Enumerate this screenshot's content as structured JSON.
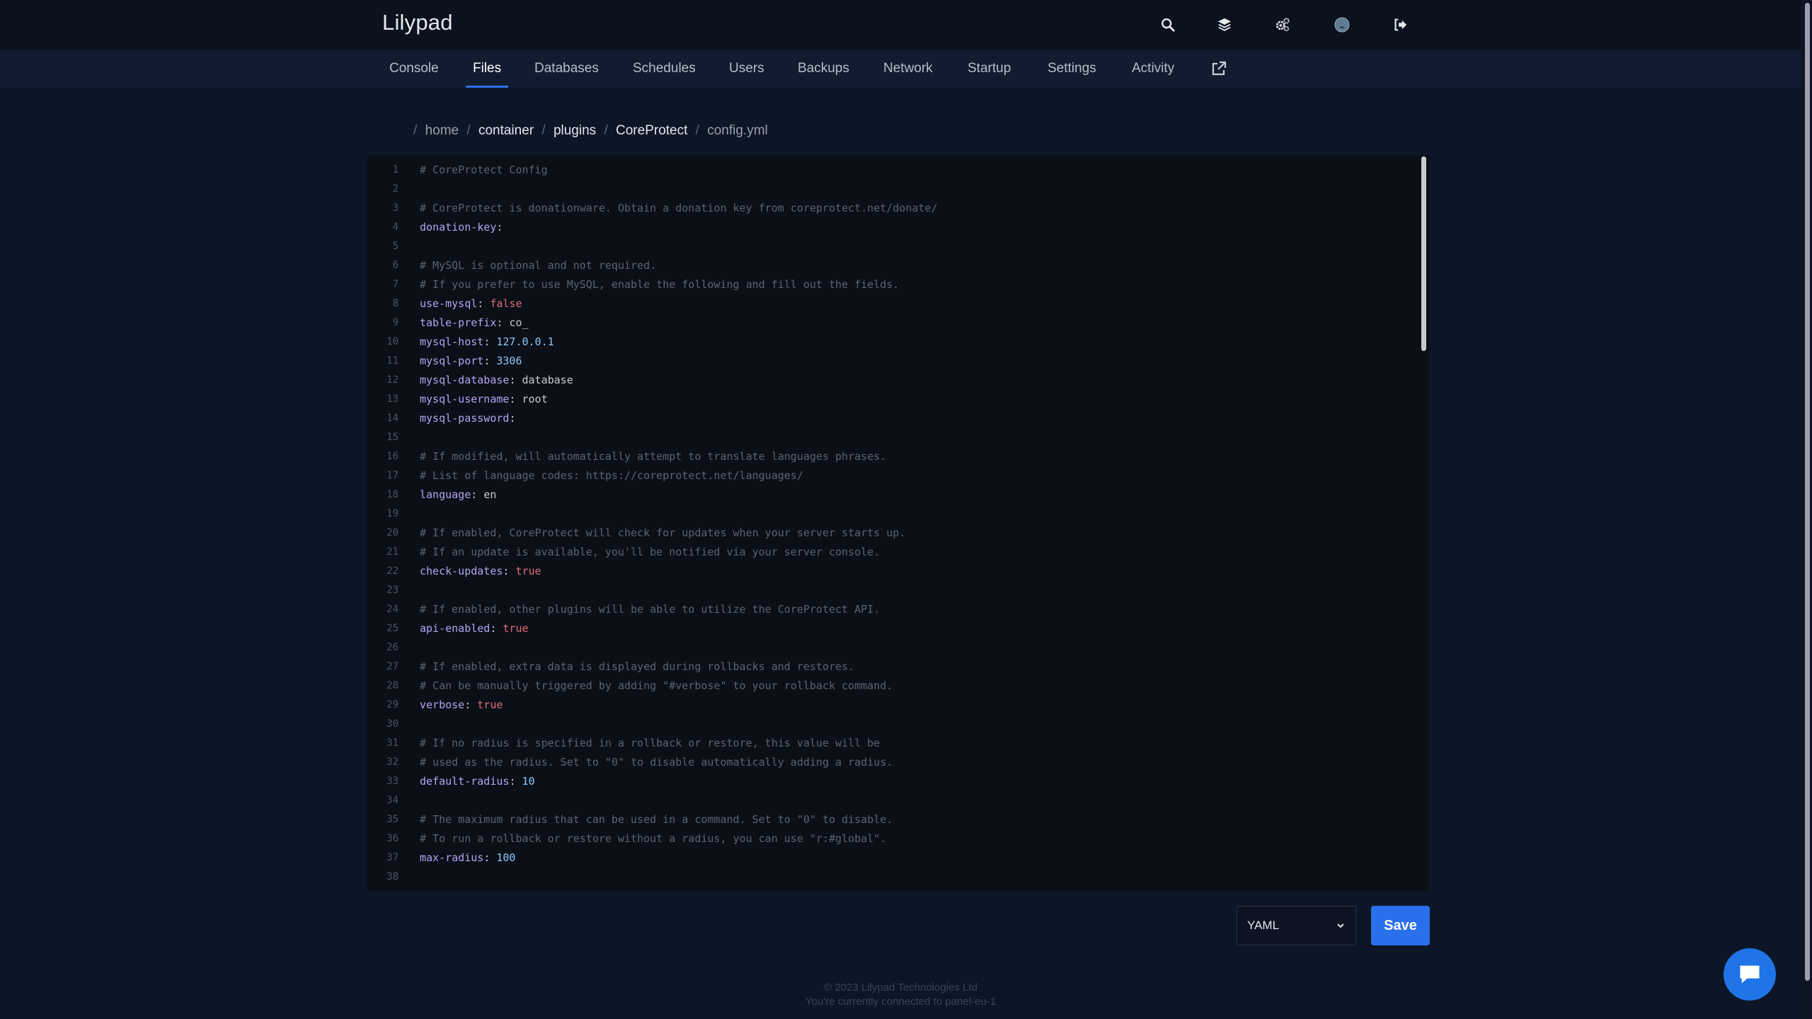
{
  "app": {
    "brand": "Lilypad"
  },
  "header_icons": [
    "search-icon",
    "layers-icon",
    "gears-icon",
    "avatar",
    "logout-icon"
  ],
  "nav": {
    "tabs": [
      {
        "label": "Console"
      },
      {
        "label": "Files",
        "active": true
      },
      {
        "label": "Databases"
      },
      {
        "label": "Schedules"
      },
      {
        "label": "Users"
      },
      {
        "label": "Backups"
      },
      {
        "label": "Network"
      },
      {
        "label": "Startup"
      },
      {
        "label": "Settings"
      },
      {
        "label": "Activity"
      }
    ],
    "external_icon": "external-link-icon"
  },
  "breadcrumb": {
    "items": [
      "home",
      "container",
      "plugins",
      "CoreProtect",
      "config.yml"
    ]
  },
  "editor": {
    "lines": [
      [
        {
          "t": "comment",
          "v": "# CoreProtect Config"
        }
      ],
      [],
      [
        {
          "t": "comment",
          "v": "# CoreProtect is donationware. Obtain a donation key from coreprotect.net/donate/"
        }
      ],
      [
        {
          "t": "key",
          "v": "donation-key"
        },
        {
          "t": "punct",
          "v": ":"
        }
      ],
      [],
      [
        {
          "t": "comment",
          "v": "# MySQL is optional and not required."
        }
      ],
      [
        {
          "t": "comment",
          "v": "# If you prefer to use MySQL, enable the following and fill out the fields."
        }
      ],
      [
        {
          "t": "key",
          "v": "use-mysql"
        },
        {
          "t": "punct",
          "v": ": "
        },
        {
          "t": "bool",
          "v": "false"
        }
      ],
      [
        {
          "t": "key",
          "v": "table-prefix"
        },
        {
          "t": "punct",
          "v": ": "
        },
        {
          "t": "str",
          "v": "co_"
        }
      ],
      [
        {
          "t": "key",
          "v": "mysql-host"
        },
        {
          "t": "punct",
          "v": ": "
        },
        {
          "t": "num",
          "v": "127.0.0.1"
        }
      ],
      [
        {
          "t": "key",
          "v": "mysql-port"
        },
        {
          "t": "punct",
          "v": ": "
        },
        {
          "t": "num",
          "v": "3306"
        }
      ],
      [
        {
          "t": "key",
          "v": "mysql-database"
        },
        {
          "t": "punct",
          "v": ": "
        },
        {
          "t": "str",
          "v": "database"
        }
      ],
      [
        {
          "t": "key",
          "v": "mysql-username"
        },
        {
          "t": "punct",
          "v": ": "
        },
        {
          "t": "str",
          "v": "root"
        }
      ],
      [
        {
          "t": "key",
          "v": "mysql-password"
        },
        {
          "t": "punct",
          "v": ":"
        }
      ],
      [],
      [
        {
          "t": "comment",
          "v": "# If modified, will automatically attempt to translate languages phrases."
        }
      ],
      [
        {
          "t": "comment",
          "v": "# List of language codes: https://coreprotect.net/languages/"
        }
      ],
      [
        {
          "t": "key",
          "v": "language"
        },
        {
          "t": "punct",
          "v": ": "
        },
        {
          "t": "str",
          "v": "en"
        }
      ],
      [],
      [
        {
          "t": "comment",
          "v": "# If enabled, CoreProtect will check for updates when your server starts up."
        }
      ],
      [
        {
          "t": "comment",
          "v": "# If an update is available, you'll be notified via your server console."
        }
      ],
      [
        {
          "t": "key",
          "v": "check-updates"
        },
        {
          "t": "punct",
          "v": ": "
        },
        {
          "t": "bool",
          "v": "true"
        }
      ],
      [],
      [
        {
          "t": "comment",
          "v": "# If enabled, other plugins will be able to utilize the CoreProtect API."
        }
      ],
      [
        {
          "t": "key",
          "v": "api-enabled"
        },
        {
          "t": "punct",
          "v": ": "
        },
        {
          "t": "bool",
          "v": "true"
        }
      ],
      [],
      [
        {
          "t": "comment",
          "v": "# If enabled, extra data is displayed during rollbacks and restores."
        }
      ],
      [
        {
          "t": "comment",
          "v": "# Can be manually triggered by adding \"#verbose\" to your rollback command."
        }
      ],
      [
        {
          "t": "key",
          "v": "verbose"
        },
        {
          "t": "punct",
          "v": ": "
        },
        {
          "t": "bool",
          "v": "true"
        }
      ],
      [],
      [
        {
          "t": "comment",
          "v": "# If no radius is specified in a rollback or restore, this value will be"
        }
      ],
      [
        {
          "t": "comment",
          "v": "# used as the radius. Set to \"0\" to disable automatically adding a radius."
        }
      ],
      [
        {
          "t": "key",
          "v": "default-radius"
        },
        {
          "t": "punct",
          "v": ": "
        },
        {
          "t": "num",
          "v": "10"
        }
      ],
      [],
      [
        {
          "t": "comment",
          "v": "# The maximum radius that can be used in a command. Set to \"0\" to disable."
        }
      ],
      [
        {
          "t": "comment",
          "v": "# To run a rollback or restore without a radius, you can use \"r:#global\"."
        }
      ],
      [
        {
          "t": "key",
          "v": "max-radius"
        },
        {
          "t": "punct",
          "v": ": "
        },
        {
          "t": "num",
          "v": "100"
        }
      ],
      []
    ]
  },
  "controls": {
    "language_value": "YAML",
    "save_label": "Save"
  },
  "footer": {
    "copyright": "© 2023 Lilypad Technologies Ltd",
    "connection": "You're currently connected to panel-eu-1"
  },
  "colors": {
    "accent": "#2a6fec",
    "background": "#0d1627",
    "topbar": "#0b111d",
    "navbar": "#111c30"
  }
}
